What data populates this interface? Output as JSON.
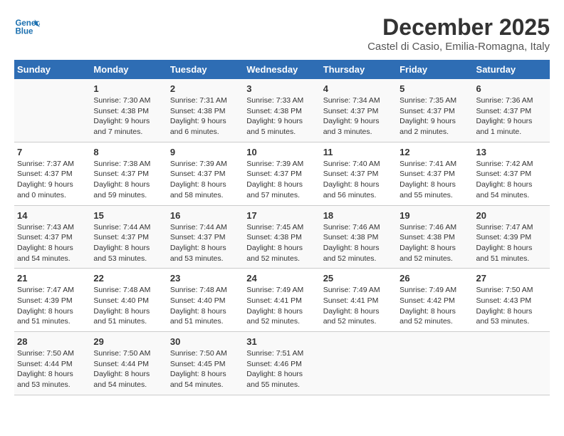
{
  "logo": {
    "line1": "General",
    "line2": "Blue"
  },
  "title": "December 2025",
  "subtitle": "Castel di Casio, Emilia-Romagna, Italy",
  "days_header": [
    "Sunday",
    "Monday",
    "Tuesday",
    "Wednesday",
    "Thursday",
    "Friday",
    "Saturday"
  ],
  "weeks": [
    [
      {
        "day": "",
        "info": ""
      },
      {
        "day": "1",
        "info": "Sunrise: 7:30 AM\nSunset: 4:38 PM\nDaylight: 9 hours\nand 7 minutes."
      },
      {
        "day": "2",
        "info": "Sunrise: 7:31 AM\nSunset: 4:38 PM\nDaylight: 9 hours\nand 6 minutes."
      },
      {
        "day": "3",
        "info": "Sunrise: 7:33 AM\nSunset: 4:38 PM\nDaylight: 9 hours\nand 5 minutes."
      },
      {
        "day": "4",
        "info": "Sunrise: 7:34 AM\nSunset: 4:37 PM\nDaylight: 9 hours\nand 3 minutes."
      },
      {
        "day": "5",
        "info": "Sunrise: 7:35 AM\nSunset: 4:37 PM\nDaylight: 9 hours\nand 2 minutes."
      },
      {
        "day": "6",
        "info": "Sunrise: 7:36 AM\nSunset: 4:37 PM\nDaylight: 9 hours\nand 1 minute."
      }
    ],
    [
      {
        "day": "7",
        "info": "Sunrise: 7:37 AM\nSunset: 4:37 PM\nDaylight: 9 hours\nand 0 minutes."
      },
      {
        "day": "8",
        "info": "Sunrise: 7:38 AM\nSunset: 4:37 PM\nDaylight: 8 hours\nand 59 minutes."
      },
      {
        "day": "9",
        "info": "Sunrise: 7:39 AM\nSunset: 4:37 PM\nDaylight: 8 hours\nand 58 minutes."
      },
      {
        "day": "10",
        "info": "Sunrise: 7:39 AM\nSunset: 4:37 PM\nDaylight: 8 hours\nand 57 minutes."
      },
      {
        "day": "11",
        "info": "Sunrise: 7:40 AM\nSunset: 4:37 PM\nDaylight: 8 hours\nand 56 minutes."
      },
      {
        "day": "12",
        "info": "Sunrise: 7:41 AM\nSunset: 4:37 PM\nDaylight: 8 hours\nand 55 minutes."
      },
      {
        "day": "13",
        "info": "Sunrise: 7:42 AM\nSunset: 4:37 PM\nDaylight: 8 hours\nand 54 minutes."
      }
    ],
    [
      {
        "day": "14",
        "info": "Sunrise: 7:43 AM\nSunset: 4:37 PM\nDaylight: 8 hours\nand 54 minutes."
      },
      {
        "day": "15",
        "info": "Sunrise: 7:44 AM\nSunset: 4:37 PM\nDaylight: 8 hours\nand 53 minutes."
      },
      {
        "day": "16",
        "info": "Sunrise: 7:44 AM\nSunset: 4:37 PM\nDaylight: 8 hours\nand 53 minutes."
      },
      {
        "day": "17",
        "info": "Sunrise: 7:45 AM\nSunset: 4:38 PM\nDaylight: 8 hours\nand 52 minutes."
      },
      {
        "day": "18",
        "info": "Sunrise: 7:46 AM\nSunset: 4:38 PM\nDaylight: 8 hours\nand 52 minutes."
      },
      {
        "day": "19",
        "info": "Sunrise: 7:46 AM\nSunset: 4:38 PM\nDaylight: 8 hours\nand 52 minutes."
      },
      {
        "day": "20",
        "info": "Sunrise: 7:47 AM\nSunset: 4:39 PM\nDaylight: 8 hours\nand 51 minutes."
      }
    ],
    [
      {
        "day": "21",
        "info": "Sunrise: 7:47 AM\nSunset: 4:39 PM\nDaylight: 8 hours\nand 51 minutes."
      },
      {
        "day": "22",
        "info": "Sunrise: 7:48 AM\nSunset: 4:40 PM\nDaylight: 8 hours\nand 51 minutes."
      },
      {
        "day": "23",
        "info": "Sunrise: 7:48 AM\nSunset: 4:40 PM\nDaylight: 8 hours\nand 51 minutes."
      },
      {
        "day": "24",
        "info": "Sunrise: 7:49 AM\nSunset: 4:41 PM\nDaylight: 8 hours\nand 52 minutes."
      },
      {
        "day": "25",
        "info": "Sunrise: 7:49 AM\nSunset: 4:41 PM\nDaylight: 8 hours\nand 52 minutes."
      },
      {
        "day": "26",
        "info": "Sunrise: 7:49 AM\nSunset: 4:42 PM\nDaylight: 8 hours\nand 52 minutes."
      },
      {
        "day": "27",
        "info": "Sunrise: 7:50 AM\nSunset: 4:43 PM\nDaylight: 8 hours\nand 53 minutes."
      }
    ],
    [
      {
        "day": "28",
        "info": "Sunrise: 7:50 AM\nSunset: 4:44 PM\nDaylight: 8 hours\nand 53 minutes."
      },
      {
        "day": "29",
        "info": "Sunrise: 7:50 AM\nSunset: 4:44 PM\nDaylight: 8 hours\nand 54 minutes."
      },
      {
        "day": "30",
        "info": "Sunrise: 7:50 AM\nSunset: 4:45 PM\nDaylight: 8 hours\nand 54 minutes."
      },
      {
        "day": "31",
        "info": "Sunrise: 7:51 AM\nSunset: 4:46 PM\nDaylight: 8 hours\nand 55 minutes."
      },
      {
        "day": "",
        "info": ""
      },
      {
        "day": "",
        "info": ""
      },
      {
        "day": "",
        "info": ""
      }
    ]
  ]
}
